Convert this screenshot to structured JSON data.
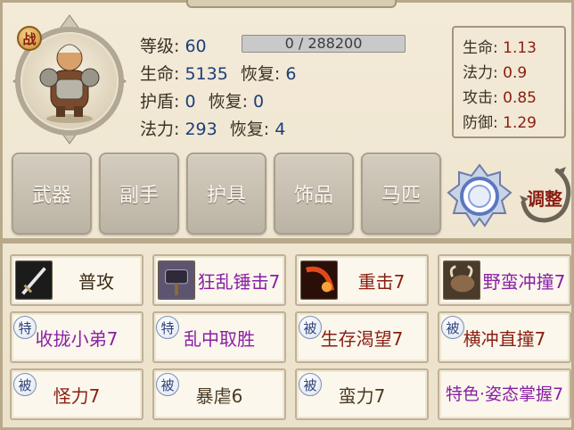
{
  "portrait": {
    "badge": "战"
  },
  "stats": {
    "level_label": "等级:",
    "level": "60",
    "exp_text": "0 / 288200",
    "exp_fraction": 0,
    "hp_label": "生命:",
    "hp": "5135",
    "hp_regen_label": "恢复:",
    "hp_regen": "6",
    "shield_label": "护盾:",
    "shield": "0",
    "shield_regen_label": "恢复:",
    "shield_regen": "0",
    "mp_label": "法力:",
    "mp": "293",
    "mp_regen_label": "恢复:",
    "mp_regen": "4"
  },
  "coefficients": [
    {
      "label": "生命:",
      "value": "1.13"
    },
    {
      "label": "法力:",
      "value": "0.9"
    },
    {
      "label": "攻击:",
      "value": "0.85"
    },
    {
      "label": "防御:",
      "value": "1.29"
    }
  ],
  "equipment": [
    "武器",
    "副手",
    "护具",
    "饰品",
    "马匹"
  ],
  "adjust_label": "调整",
  "skills": [
    {
      "name": "普攻",
      "icon": "sword-icon",
      "color": "#3b2a14"
    },
    {
      "name": "狂乱锤击7",
      "icon": "hammer-icon",
      "color": "#8a1fa6"
    },
    {
      "name": "重击7",
      "icon": "strike-icon",
      "color": "#8a1e12"
    },
    {
      "name": "野蛮冲撞7",
      "icon": "beast-icon",
      "color": "#8a1fa6"
    },
    {
      "name": "收拢小弟7",
      "tag": "特",
      "color": "#8a1fa6"
    },
    {
      "name": "乱中取胜",
      "tag": "特",
      "color": "#8a1fa6"
    },
    {
      "name": "生存渴望7",
      "tag": "被",
      "color": "#8a1e12"
    },
    {
      "name": "横冲直撞7",
      "tag": "被",
      "color": "#8a1e12"
    },
    {
      "name": "怪力7",
      "tag": "被",
      "color": "#8a1e12"
    },
    {
      "name": "暴虐6",
      "tag": "被",
      "color": "#4a3a22"
    },
    {
      "name": "蛮力7",
      "tag": "被",
      "color": "#4a3a22"
    },
    {
      "name": "特色·姿态掌握7",
      "color": "#8a1fa6"
    }
  ]
}
